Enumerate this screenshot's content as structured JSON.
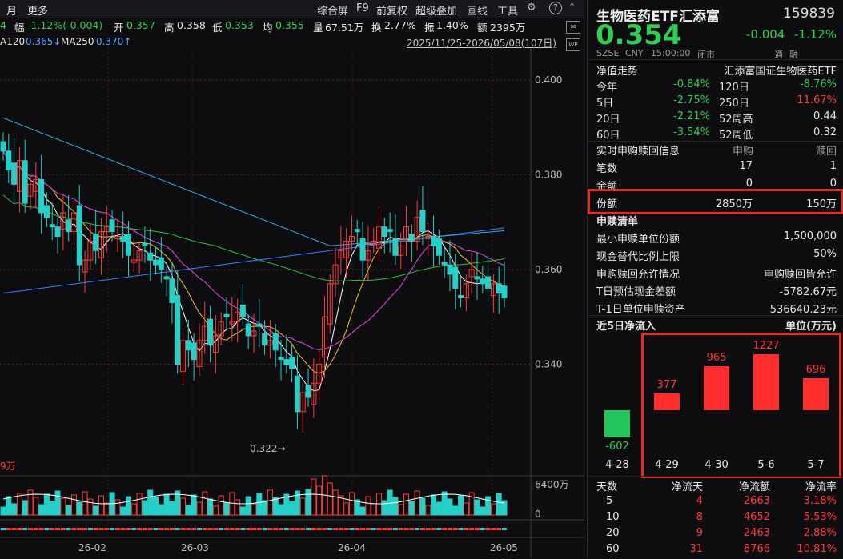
{
  "toolbar": {
    "left_items": [
      "月",
      "更多"
    ],
    "right_items": [
      "综合屏",
      "F9",
      "前复权",
      "超级叠加",
      "画线",
      "工具"
    ]
  },
  "stats": {
    "lead": "4",
    "amp_label": "幅",
    "amp_val": "-1.12%(-0.004)",
    "open_label": "开",
    "open_val": "0.357",
    "high_label": "高",
    "high_val": "0.358",
    "low_label": "低",
    "low_val": "0.353",
    "avg_label": "均",
    "avg_val": "0.355",
    "vol_label": "量",
    "vol_val": "67.51万",
    "turn_label": "换",
    "turn_val": "2.77%",
    "swing_label": "振",
    "swing_val": "1.40%",
    "amount_label": "额",
    "amount_val": "2395万"
  },
  "ma_legend": {
    "ma120_label": "A120",
    "ma120_val": "0.365↓",
    "ma250_label": "MA250",
    "ma250_val": "0.370↑",
    "range": "2025/11/25-2026/05/08(107日)"
  },
  "axis": {
    "prices": [
      "0.400",
      "0.380",
      "0.360",
      "0.340"
    ],
    "low_marker": "0.322",
    "vol_top": "6400万",
    "vol_zero": "0",
    "vol_legend": "9万",
    "dates": [
      "26-02",
      "26-03",
      "26-04",
      "26-05"
    ]
  },
  "colors": {
    "up": "#ff3b3b",
    "down": "#25d0c8",
    "ma5": "#ffffff",
    "ma10": "#f2c230",
    "ma20": "#d84fe0",
    "ma60": "#33bb44",
    "ma120": "#3a7dff",
    "ma250": "#3aa8d8"
  },
  "quote": {
    "title": "生物医药ETF汇添富",
    "code": "159839",
    "price": "0.354",
    "change": "-0.004",
    "change_pct": "-1.12%",
    "exchange": "SZSE",
    "currency": "CNY",
    "time": "15:00:00",
    "status": "闭市",
    "badges": [
      "通",
      "融"
    ]
  },
  "nav": {
    "header_label": "净值走势",
    "header_value": "汇添富国证生物医药ETF",
    "rows": [
      {
        "l1": "今年",
        "v1": "-0.84%",
        "l2": "120日",
        "v2": "-8.76%"
      },
      {
        "l1": "5日",
        "v1": "-2.75%",
        "l2": "250日",
        "v2": "11.67%"
      },
      {
        "l1": "20日",
        "v1": "-2.21%",
        "l2": "52周高",
        "v2": "0.44"
      },
      {
        "l1": "60日",
        "v1": "-3.54%",
        "l2": "52周低",
        "v2": "0.32"
      }
    ]
  },
  "subscribe": {
    "header": "实时申购赎回信息",
    "col1": "申购",
    "col2": "赎回",
    "rows": [
      {
        "label": "笔数",
        "sub": "17",
        "red": "1"
      },
      {
        "label": "金额",
        "sub": "0",
        "red": "0"
      },
      {
        "label": "份额",
        "sub": "2850万",
        "red": "150万"
      }
    ]
  },
  "creation": {
    "header": "申赎清单",
    "rows": [
      {
        "label": "最小申赎单位份额",
        "value": "1,500,000"
      },
      {
        "label": "现金替代比例上限",
        "value": "50%"
      },
      {
        "label": "申购赎回允许情况",
        "value": "申购赎回皆允许"
      },
      {
        "label": "T日预估现金差额",
        "value": "-5782.67元"
      },
      {
        "label": "T-1日单位申赎资产",
        "value": "536640.23元"
      }
    ]
  },
  "flow": {
    "header": "近5日净流入",
    "unit": "单位(万元)",
    "bars": [
      {
        "date": "4-28",
        "value": -602
      },
      {
        "date": "4-29",
        "value": 377
      },
      {
        "date": "4-30",
        "value": 965
      },
      {
        "date": "5-6",
        "value": 1227
      },
      {
        "date": "5-7",
        "value": 696
      }
    ]
  },
  "flow_table": {
    "headers": [
      "天数",
      "净流天",
      "净流额",
      "净流率"
    ],
    "rows": [
      [
        "5",
        "4",
        "2663",
        "3.18%"
      ],
      [
        "10",
        "8",
        "4652",
        "5.53%"
      ],
      [
        "20",
        "9",
        "2463",
        "2.88%"
      ],
      [
        "60",
        "31",
        "8766",
        "10.81%"
      ]
    ]
  }
}
